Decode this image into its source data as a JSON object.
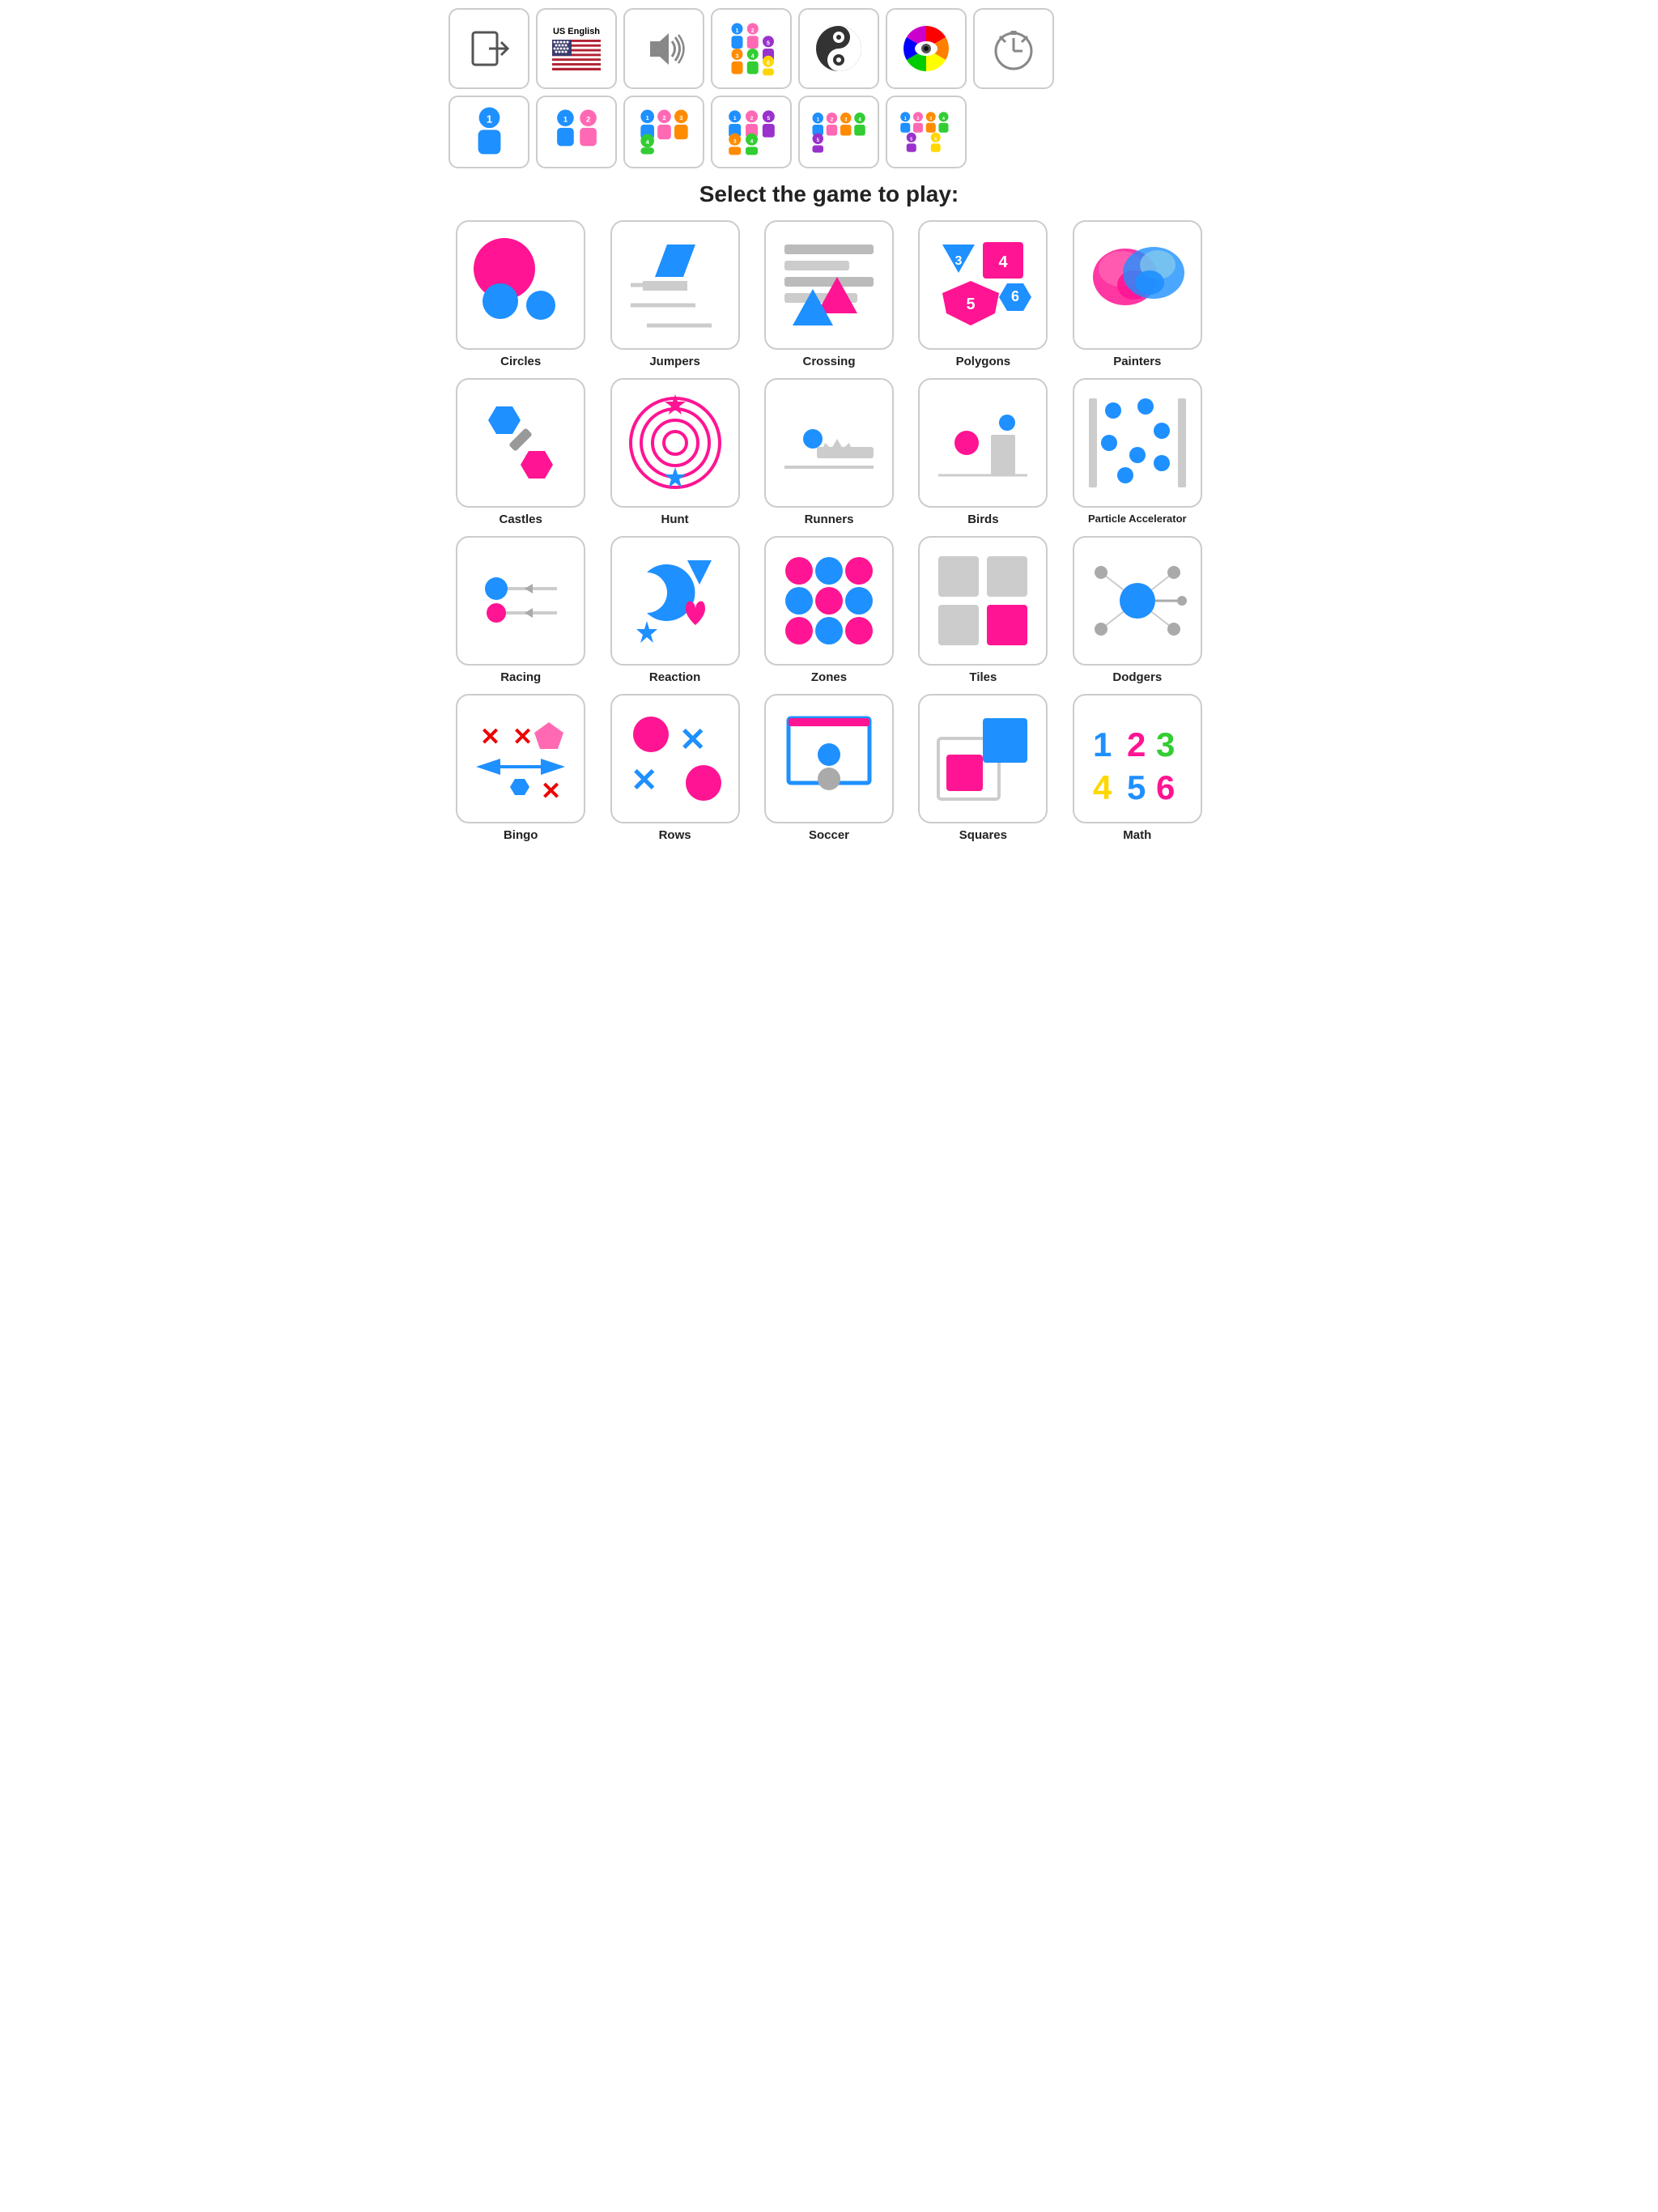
{
  "toolbar": {
    "exit_label": "Exit",
    "language_label": "US English",
    "sound_label": "Sound",
    "players_label": "Players",
    "yin_yang_label": "Yin Yang",
    "color_wheel_label": "Color Wheel",
    "timer_label": "Timer"
  },
  "section_title": "Select the game to play:",
  "games": [
    {
      "id": "circles",
      "label": "Circles"
    },
    {
      "id": "jumpers",
      "label": "Jumpers"
    },
    {
      "id": "crossing",
      "label": "Crossing"
    },
    {
      "id": "polygons",
      "label": "Polygons"
    },
    {
      "id": "painters",
      "label": "Painters"
    },
    {
      "id": "castles",
      "label": "Castles"
    },
    {
      "id": "hunt",
      "label": "Hunt"
    },
    {
      "id": "runners",
      "label": "Runners"
    },
    {
      "id": "birds",
      "label": "Birds"
    },
    {
      "id": "particle-accelerator",
      "label": "Particle Accelerator"
    },
    {
      "id": "racing",
      "label": "Racing"
    },
    {
      "id": "reaction",
      "label": "Reaction"
    },
    {
      "id": "zones",
      "label": "Zones"
    },
    {
      "id": "tiles",
      "label": "Tiles"
    },
    {
      "id": "dodgers",
      "label": "Dodgers"
    },
    {
      "id": "bingo",
      "label": "Bingo"
    },
    {
      "id": "rows",
      "label": "Rows"
    },
    {
      "id": "soccer",
      "label": "Soccer"
    },
    {
      "id": "squares",
      "label": "Squares"
    },
    {
      "id": "math",
      "label": "Math"
    }
  ]
}
